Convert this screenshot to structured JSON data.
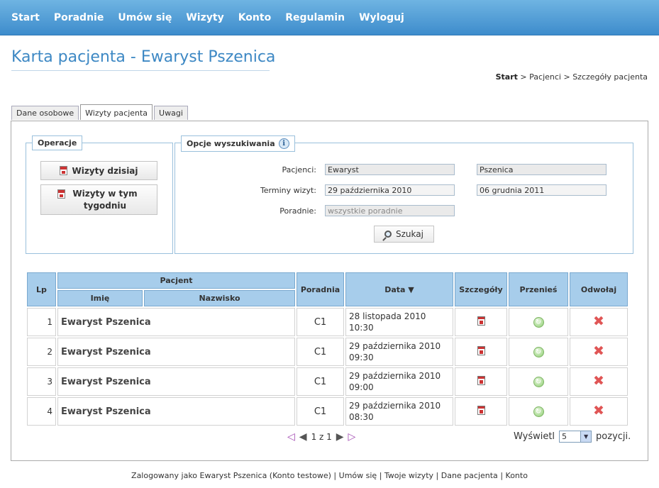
{
  "nav": {
    "items": [
      "Start",
      "Poradnie",
      "Umów się",
      "Wizyty",
      "Konto",
      "Regulamin",
      "Wyloguj"
    ]
  },
  "page": {
    "title": "Karta pacjenta - Ewaryst Pszenica",
    "breadcrumb": {
      "home": "Start",
      "sep": ">",
      "level1": "Pacjenci",
      "level2": "Szczegóły pacjenta"
    }
  },
  "tabs": [
    "Dane osobowe",
    "Wizyty pacjenta",
    "Uwagi"
  ],
  "operations": {
    "legend": "Operacje",
    "today": "Wizyty dzisiaj",
    "week": "Wizyty w tym tygodniu"
  },
  "search": {
    "legend": "Opcje wyszukiwania",
    "info_icon": "i",
    "patients_label": "Pacjenci:",
    "first_name": "Ewaryst",
    "last_name": "Pszenica",
    "dates_label": "Terminy wizyt:",
    "date_from": "29 października 2010",
    "date_to": "06 grudnia 2011",
    "clinics_label": "Poradnie:",
    "clinics_placeholder": "wszystkie poradnie",
    "search_button": "Szukaj"
  },
  "table": {
    "headers": {
      "lp": "Lp",
      "patient": "Pacjent",
      "first": "Imię",
      "last": "Nazwisko",
      "clinic": "Poradnia",
      "date": "Data ▼",
      "details": "Szczegóły",
      "move": "Przenieś",
      "cancel": "Odwołaj"
    },
    "rows": [
      {
        "lp": "1",
        "name": "Ewaryst Pszenica",
        "clinic": "C1",
        "date": "28 listopada 2010",
        "time": "10:30"
      },
      {
        "lp": "2",
        "name": "Ewaryst Pszenica",
        "clinic": "C1",
        "date": "29 października 2010",
        "time": "09:30"
      },
      {
        "lp": "3",
        "name": "Ewaryst Pszenica",
        "clinic": "C1",
        "date": "29 października 2010",
        "time": "09:00"
      },
      {
        "lp": "4",
        "name": "Ewaryst Pszenica",
        "clinic": "C1",
        "date": "29 października 2010",
        "time": "08:30"
      }
    ]
  },
  "pager": {
    "text": "1 z 1",
    "show_label": "Wyświetl",
    "per_page": "5",
    "items_label": "pozycji."
  },
  "footer": {
    "logged_as": "Zalogowany jako Ewaryst Pszenica (Konto testowe)",
    "sep": "|",
    "link1": "Umów się",
    "link2": "Twoje wizyty",
    "link3": "Dane pacjenta",
    "link4": "Konto"
  },
  "colors": {
    "nav_gradient_top": "#6fb4e2",
    "nav_gradient_bottom": "#3d8ccc",
    "title": "#3d88c4",
    "table_header": "#a7cdeb"
  }
}
